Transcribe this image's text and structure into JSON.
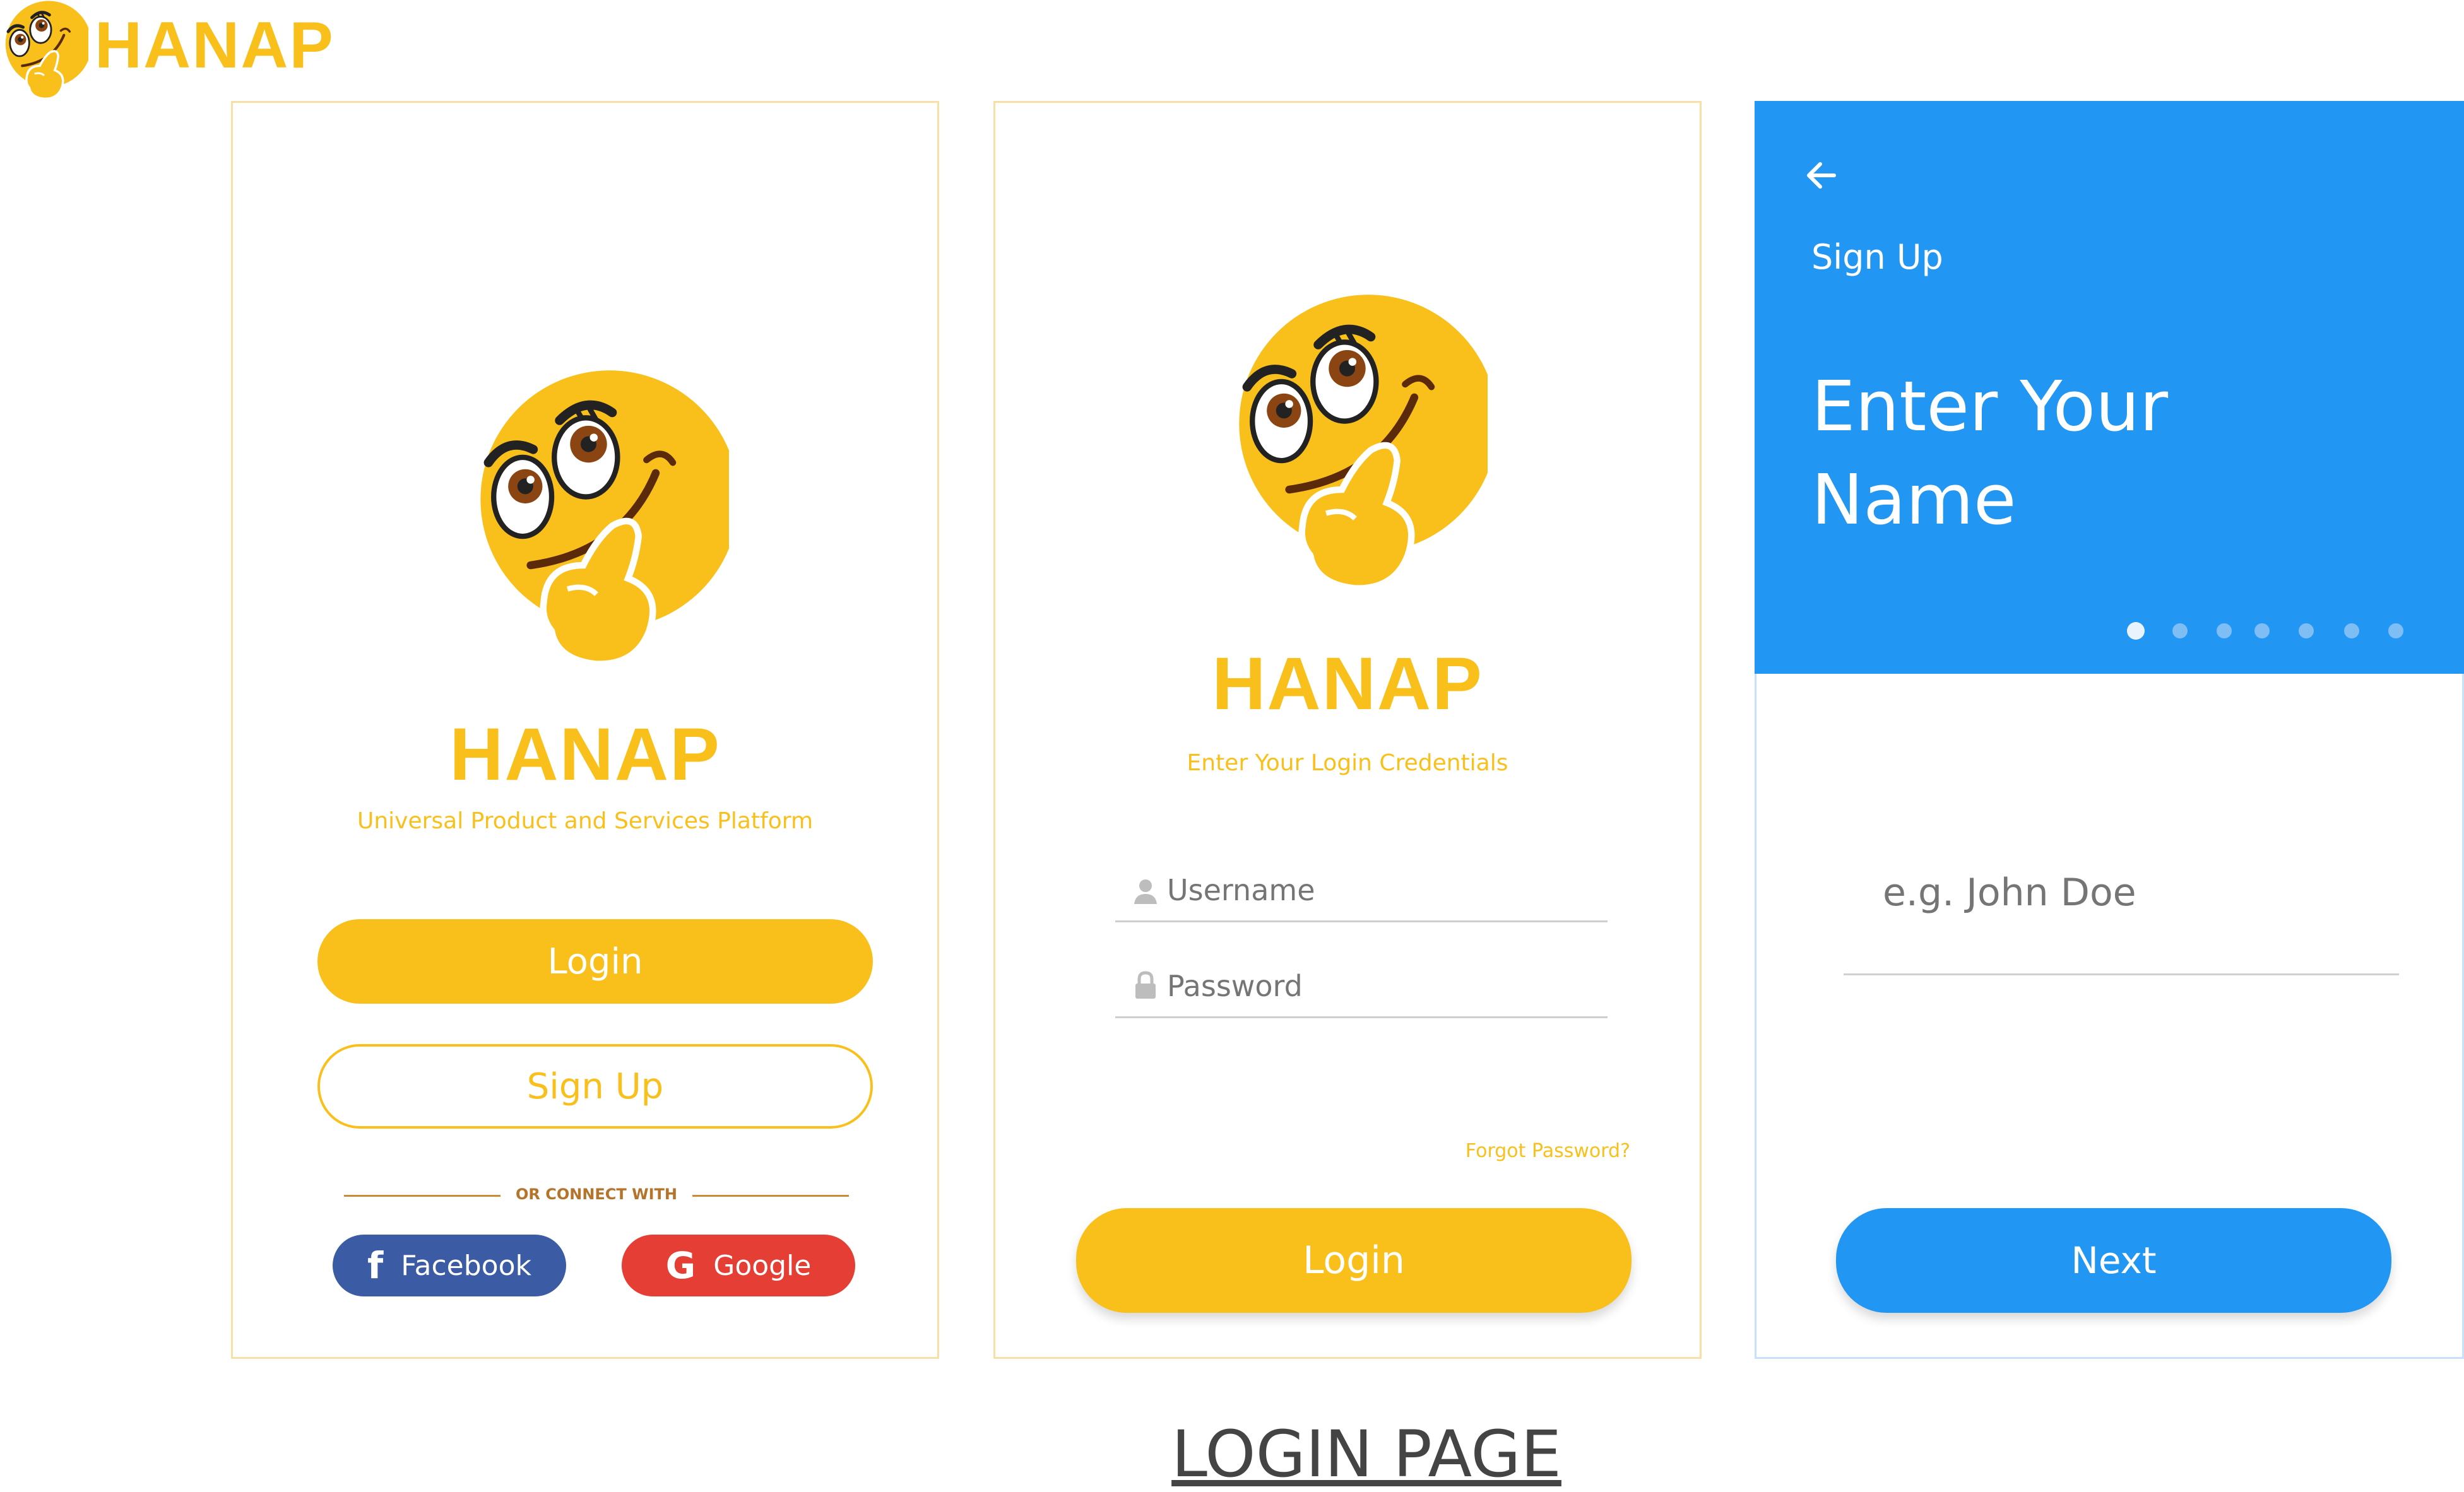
{
  "header": {
    "brand": "HANAP"
  },
  "welcome": {
    "brand": "HANAP",
    "tagline": "Universal Product and Services Platform",
    "login_label": "Login",
    "signup_label": "Sign Up",
    "divider_text": "OR CONNECT WITH",
    "facebook_label": "Facebook",
    "google_label": "Google"
  },
  "login": {
    "brand": "HANAP",
    "subtitle": "Enter Your Login Credentials",
    "username_placeholder": "Username",
    "password_placeholder": "Password",
    "forgot_label": "Forgot Password?",
    "login_label": "Login"
  },
  "signup": {
    "header_label": "Sign Up",
    "heading_line1": "Enter Your",
    "heading_line2": "Name",
    "step_current": 1,
    "step_total": 7,
    "name_placeholder": "e.g. John Doe",
    "next_label": "Next"
  },
  "caption": "LOGIN PAGE",
  "colors": {
    "brand_yellow": "#F9C01C",
    "signup_blue": "#2196F3",
    "facebook": "#3B5BA5",
    "google": "#E53E35",
    "border_yellow": "#F7E0A8"
  }
}
